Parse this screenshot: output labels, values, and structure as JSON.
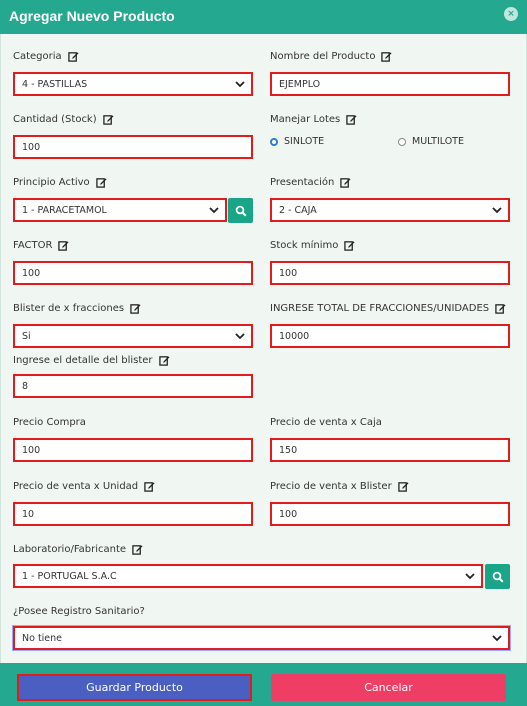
{
  "modal": {
    "title": "Agregar Nuevo Producto",
    "close_label": "×"
  },
  "form": {
    "categoria": {
      "label": "Categoria",
      "value": "4 - PASTILLAS"
    },
    "nombre": {
      "label": "Nombre del Producto",
      "value": "EJEMPLO"
    },
    "cantidad": {
      "label": "Cantidad (Stock)",
      "value": "100"
    },
    "lotes": {
      "label": "Manejar Lotes",
      "option_1": "SINLOTE",
      "option_2": "MULTILOTE",
      "selected": "SINLOTE"
    },
    "principio": {
      "label": "Principio Activo",
      "value": "1 - PARACETAMOL"
    },
    "presentacion": {
      "label": "Presentación",
      "value": "2 - CAJA"
    },
    "factor": {
      "label": "FACTOR",
      "value": "100"
    },
    "stock_min": {
      "label": "Stock mínimo",
      "value": "100"
    },
    "blister": {
      "label": "Blister de x fracciones",
      "value": "Si"
    },
    "total_fracciones": {
      "label": "INGRESE TOTAL DE FRACCIONES/UNIDADES",
      "value": "10000"
    },
    "detalle_blister": {
      "label": "Ingrese el detalle del blister",
      "value": "8"
    },
    "precio_compra": {
      "label": "Precio Compra",
      "value": "100"
    },
    "precio_caja": {
      "label": "Precio de venta x Caja",
      "value": "150"
    },
    "precio_unidad": {
      "label": "Precio de venta x Unidad",
      "value": "10"
    },
    "precio_blister": {
      "label": "Precio de venta x Blister",
      "value": "100"
    },
    "laboratorio": {
      "label": "Laboratorio/Fabricante",
      "value": "1 - PORTUGAL S.A.C"
    },
    "registro": {
      "label": "¿Posee Registro Sanitario?",
      "value": "No tiene"
    }
  },
  "footer": {
    "save_label": "Guardar Producto",
    "cancel_label": "Cancelar"
  },
  "colors": {
    "header": "#25a890",
    "field_border": "#e21c1c",
    "save_button": "#4a5fc1",
    "cancel_button": "#ef3e66",
    "search_button": "#1aa588"
  }
}
